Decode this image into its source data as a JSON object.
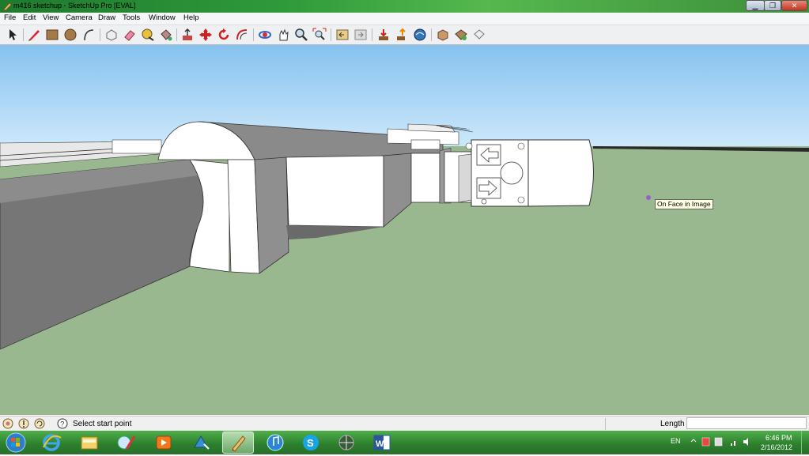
{
  "window": {
    "title": "m416 sketchup - SketchUp Pro [EVAL]",
    "controls": [
      "minimize",
      "maximize",
      "close"
    ]
  },
  "menu": [
    "File",
    "Edit",
    "View",
    "Camera",
    "Draw",
    "Tools",
    "Window",
    "Help"
  ],
  "toolbar": {
    "tools": [
      "select-icon",
      "pencil-icon",
      "rectangle-icon",
      "circle-icon",
      "arc-icon",
      "make-component-icon",
      "eraser-icon",
      "tape-measure-icon",
      "paint-bucket-icon",
      "push-pull-icon",
      "move-icon",
      "rotate-icon",
      "offset-icon",
      "orbit-icon",
      "pan-icon",
      "zoom-icon",
      "zoom-extents-icon",
      "previous-view-icon",
      "next-view-icon",
      "get-models-icon",
      "share-model-icon",
      "share-component-icon",
      "components-icon",
      "materials-icon",
      "styles-icon"
    ]
  },
  "viewport": {
    "tooltip": "On Face in Image",
    "colors": {
      "sky_top": "#86c2ee",
      "sky_bottom": "#cde8fb",
      "ground": "#9ab88f"
    }
  },
  "status": {
    "icons": [
      "geo-location-icon",
      "credits-icon",
      "instructor-icon",
      "help-icon"
    ],
    "message": "Select start point",
    "length_label": "Length",
    "length_value": ""
  },
  "taskbar": {
    "apps": [
      "internet-explorer-icon",
      "file-explorer-icon",
      "paint-icon",
      "media-player-icon",
      "recycle-app-icon",
      "sketchup-icon",
      "itunes-icon",
      "skype-icon",
      "network-app-icon",
      "word-icon"
    ],
    "active_app": "sketchup-icon",
    "language": "EN",
    "time": "6:46 PM",
    "date": "2/16/2012"
  }
}
